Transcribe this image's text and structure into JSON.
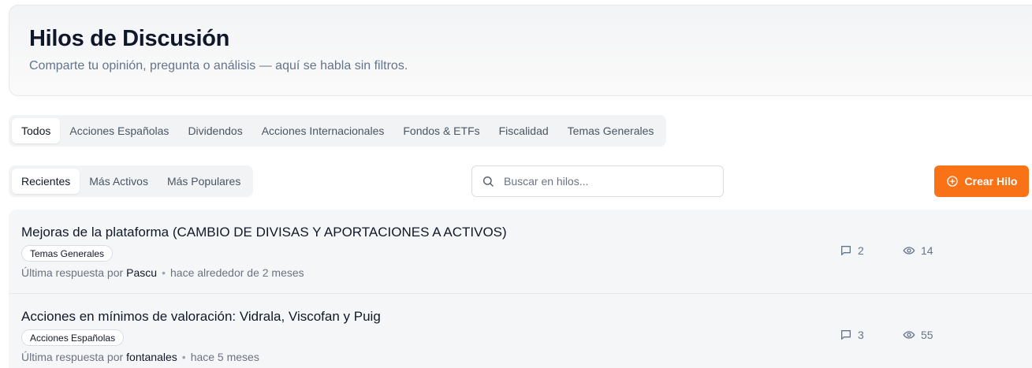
{
  "header": {
    "title": "Hilos de Discusión",
    "subtitle": "Comparte tu opinión, pregunta o análisis — aquí se habla sin filtros."
  },
  "category_tabs": [
    {
      "label": "Todos",
      "active": true
    },
    {
      "label": "Acciones Españolas",
      "active": false
    },
    {
      "label": "Dividendos",
      "active": false
    },
    {
      "label": "Acciones Internacionales",
      "active": false
    },
    {
      "label": "Fondos & ETFs",
      "active": false
    },
    {
      "label": "Fiscalidad",
      "active": false
    },
    {
      "label": "Temas Generales",
      "active": false
    }
  ],
  "sort_tabs": [
    {
      "label": "Recientes",
      "active": true
    },
    {
      "label": "Más Activos",
      "active": false
    },
    {
      "label": "Más Populares",
      "active": false
    }
  ],
  "search": {
    "placeholder": "Buscar en hilos...",
    "value": ""
  },
  "create_button": {
    "label": "Crear Hilo",
    "icon": "plus-circle-icon"
  },
  "threads": [
    {
      "title": "Mejoras de la plataforma (CAMBIO DE DIVISAS Y APORTACIONES A ACTIVOS)",
      "tag": "Temas Generales",
      "last_reply_prefix": "Última respuesta por",
      "author": "Pascu",
      "time": "hace alrededor de 2 meses",
      "replies": "2",
      "views": "14"
    },
    {
      "title": "Acciones en mínimos de valoración: Vidrala, Viscofan y Puig",
      "tag": "Acciones Españolas",
      "last_reply_prefix": "Última respuesta por",
      "author": "fontanales",
      "time": "hace 5 meses",
      "replies": "3",
      "views": "55"
    }
  ],
  "colors": {
    "accent": "#f97316",
    "text": "#111827",
    "muted": "#6b7280"
  }
}
